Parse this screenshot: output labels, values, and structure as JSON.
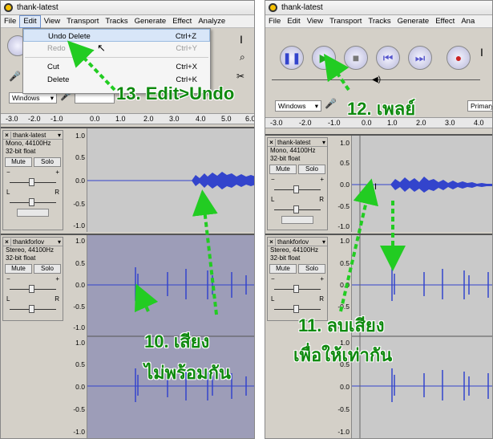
{
  "left_window": {
    "title": "thank-latest",
    "menu": [
      "File",
      "Edit",
      "View",
      "Transport",
      "Tracks",
      "Generate",
      "Effect",
      "Analyze"
    ],
    "edit_menu": {
      "items": [
        {
          "label": "Undo Delete",
          "shortcut": "Ctrl+Z"
        },
        {
          "label": "Redo",
          "shortcut": "Ctrl+Y"
        },
        {
          "label": "Cut",
          "shortcut": "Ctrl+X"
        },
        {
          "label": "Delete",
          "shortcut": "Ctrl+K"
        }
      ]
    },
    "host_combo": "Windows",
    "ruler_ticks": [
      "-3.0",
      "-2.0",
      "-1.0",
      "0.0",
      "1.0",
      "2.0",
      "3.0",
      "4.0",
      "5.0",
      "6.0"
    ],
    "track1": {
      "name": "thank-latest",
      "format": "Mono, 44100Hz",
      "bits": "32-bit float",
      "mute": "Mute",
      "solo": "Solo",
      "gain_min": "−",
      "gain_max": "+",
      "pan_l": "L",
      "pan_r": "R",
      "scale": [
        "1.0",
        "0.5",
        "0.0",
        "-0.5",
        "-1.0"
      ]
    },
    "track2": {
      "name": "thankforlov",
      "format": "Stereo, 44100Hz",
      "bits": "32-bit float",
      "mute": "Mute",
      "solo": "Solo",
      "gain_min": "−",
      "gain_max": "+",
      "pan_l": "L",
      "pan_r": "R",
      "scale": [
        "1.0",
        "0.5",
        "0.0",
        "-0.5",
        "-1.0",
        "1.0",
        "0.5",
        "0.0",
        "-0.5",
        "-1.0"
      ]
    }
  },
  "right_window": {
    "title": "thank-latest",
    "menu": [
      "File",
      "Edit",
      "View",
      "Transport",
      "Tracks",
      "Generate",
      "Effect",
      "Ana"
    ],
    "host_combo": "Windows",
    "output_combo": "Primary",
    "ruler_ticks": [
      "-3.0",
      "-2.0",
      "-1.0",
      "0.0",
      "1.0",
      "2.0",
      "3.0",
      "4.0"
    ],
    "track1": {
      "name": "thank-latest",
      "format": "Mono, 44100Hz",
      "bits": "32-bit float",
      "mute": "Mute",
      "solo": "Solo",
      "gain_min": "−",
      "gain_max": "+",
      "pan_l": "L",
      "pan_r": "R",
      "scale": [
        "1.0",
        "0.5",
        "0.0",
        "-0.5",
        "-1.0"
      ]
    },
    "track2": {
      "name": "thankforlov",
      "format": "Stereo, 44100Hz",
      "bits": "32-bit float",
      "mute": "Mute",
      "solo": "Solo",
      "gain_min": "−",
      "gain_max": "+",
      "pan_l": "L",
      "pan_r": "R",
      "scale": [
        "1.0",
        "0.5",
        "0.0",
        "-0.5",
        "-1.0",
        "1.0",
        "0.5",
        "0.0",
        "-0.5",
        "-1.0"
      ]
    }
  },
  "annotations": {
    "step13": "13. Edit>Undo",
    "step12": "12. เพลย์",
    "step10_line1": "10. เสียง",
    "step10_line2": "ไม่พร้อมกัน",
    "step11_line1": "11. ลบเสียง",
    "step11_line2": "เพื่อให้เท่ากัน"
  },
  "colors": {
    "annotation": "#0f8a0f",
    "waveform": "#3344cc",
    "selection": "#9d9db8",
    "track_bg": "#c9c9c9",
    "play": "#22aa22",
    "record": "#cc2222"
  }
}
